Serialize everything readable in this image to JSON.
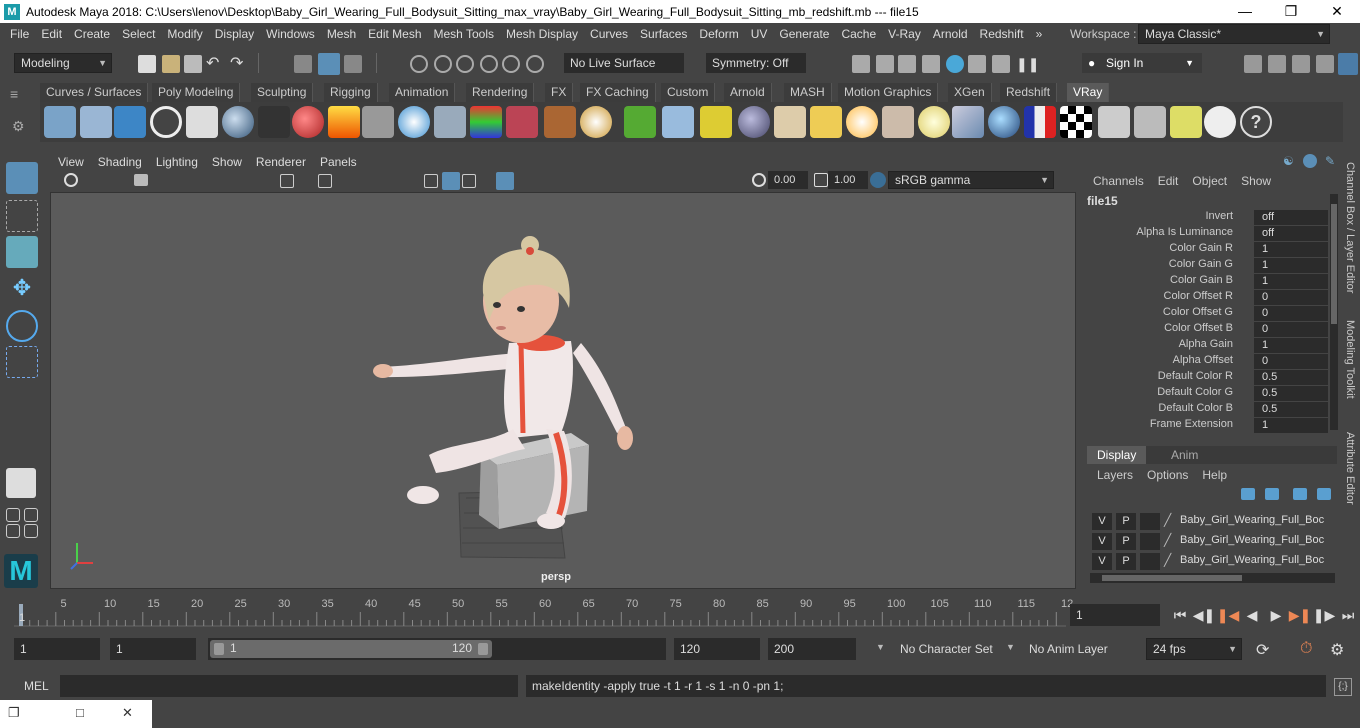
{
  "window": {
    "title": "Autodesk Maya 2018: C:\\Users\\lenov\\Desktop\\Baby_Girl_Wearing_Full_Bodysuit_Sitting_max_vray\\Baby_Girl_Wearing_Full_Bodysuit_Sitting_mb_redshift.mb  ---  file15",
    "logo_letter": "M"
  },
  "menubar": {
    "items": [
      "File",
      "Edit",
      "Create",
      "Select",
      "Modify",
      "Display",
      "Windows",
      "Mesh",
      "Edit Mesh",
      "Mesh Tools",
      "Mesh Display",
      "Curves",
      "Surfaces",
      "Deform",
      "UV",
      "Generate",
      "Cache",
      "V-Ray",
      "Arnold",
      "Redshift"
    ],
    "overflow": "»",
    "workspace_label": "Workspace :",
    "workspace_value": "Maya Classic*"
  },
  "statusline": {
    "menuset": "Modeling",
    "live_surface": "No Live Surface",
    "symmetry": "Symmetry: Off",
    "sign_in": "Sign In"
  },
  "shelf": {
    "tabs": [
      "Curves / Surfaces",
      "Poly Modeling",
      "Sculpting",
      "Rigging",
      "Animation",
      "Rendering",
      "FX",
      "FX Caching",
      "Custom",
      "Arnold",
      "MASH",
      "Motion Graphics",
      "XGen",
      "Redshift",
      "VRay"
    ],
    "active_tab": "VRay",
    "icons": [
      "vray-render-settings-icon",
      "vray-frame-buffer-icon",
      "vray-ipr-icon",
      "vray-logo-icon",
      "vray-properties-icon",
      "vray-physical-camera-icon",
      "vray-camera-icon",
      "vray-material-icon",
      "vray-fire-icon",
      "vray-plane-icon",
      "vray-sphere-light-icon",
      "vray-cone-icon",
      "vray-rect-light-icon",
      "vray-proxy-icon",
      "vray-dome-icon",
      "vray-fur-icon",
      "vray-particle-icon",
      "vray-curve-icon",
      "vray-mesh-light-icon",
      "vray-dome-light-icon",
      "vray-spot-light-icon",
      "vray-omni-light-icon",
      "vray-ies-light-icon",
      "vray-sun-icon",
      "vray-rect-icon",
      "vray-sphere-icon",
      "vray-flag-icon",
      "vray-checker-icon",
      "vray-render-icon",
      "vray-batch-icon",
      "vray-light-bulb-icon",
      "vray-cloud-icon",
      "vray-help-icon"
    ]
  },
  "viewport": {
    "menu": [
      "View",
      "Shading",
      "Lighting",
      "Show",
      "Renderer",
      "Panels"
    ],
    "exposure": "0.00",
    "gamma": "1.00",
    "color_space": "sRGB gamma",
    "camera": "persp"
  },
  "channelbox": {
    "menu": [
      "Channels",
      "Edit",
      "Object",
      "Show"
    ],
    "node": "file15",
    "attributes": [
      {
        "label": "Invert",
        "value": "off"
      },
      {
        "label": "Alpha Is Luminance",
        "value": "off"
      },
      {
        "label": "Color Gain R",
        "value": "1"
      },
      {
        "label": "Color Gain G",
        "value": "1"
      },
      {
        "label": "Color Gain B",
        "value": "1"
      },
      {
        "label": "Color Offset R",
        "value": "0"
      },
      {
        "label": "Color Offset G",
        "value": "0"
      },
      {
        "label": "Color Offset B",
        "value": "0"
      },
      {
        "label": "Alpha Gain",
        "value": "1"
      },
      {
        "label": "Alpha Offset",
        "value": "0"
      },
      {
        "label": "Default Color R",
        "value": "0.5"
      },
      {
        "label": "Default Color G",
        "value": "0.5"
      },
      {
        "label": "Default Color B",
        "value": "0.5"
      },
      {
        "label": "Frame Extension",
        "value": "1"
      }
    ],
    "side_tabs": [
      "Channel Box / Layer Editor",
      "Modeling Toolkit",
      "Attribute Editor"
    ]
  },
  "layers": {
    "tabs": [
      "Display",
      "Anim"
    ],
    "active_tab": "Display",
    "menu": [
      "Layers",
      "Options",
      "Help"
    ],
    "rows": [
      {
        "v": "V",
        "p": "P",
        "name": "Baby_Girl_Wearing_Full_Boc"
      },
      {
        "v": "V",
        "p": "P",
        "name": "Baby_Girl_Wearing_Full_Boc"
      },
      {
        "v": "V",
        "p": "P",
        "name": "Baby_Girl_Wearing_Full_Boc"
      }
    ]
  },
  "timeslider": {
    "ticks": [
      "5",
      "10",
      "15",
      "20",
      "25",
      "30",
      "35",
      "40",
      "45",
      "50",
      "55",
      "60",
      "65",
      "70",
      "75",
      "80",
      "85",
      "90",
      "95",
      "100",
      "105",
      "110",
      "115",
      "12"
    ],
    "start_label": "1",
    "current_frame": "1"
  },
  "range": {
    "start": "1",
    "playback_start": "1",
    "slider_start": "1",
    "slider_end": "120",
    "playback_end": "120",
    "end": "200",
    "character_set": "No Character Set",
    "anim_layer": "No Anim Layer",
    "fps": "24 fps"
  },
  "cmdline": {
    "label": "MEL",
    "history": "makeIdentity -apply true -t 1 -r 1 -s 1 -n 0 -pn 1;"
  }
}
